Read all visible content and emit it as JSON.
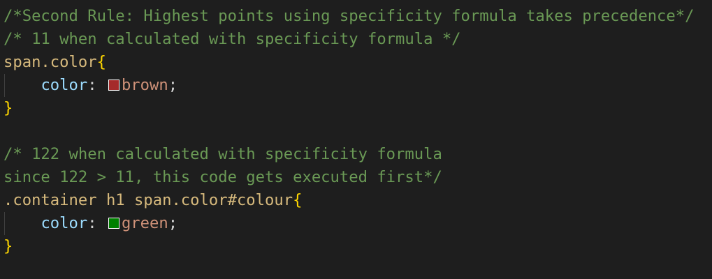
{
  "code": {
    "line1": "/*Second Rule: Highest points using specificity formula takes precedence*/",
    "line2": "/* 11 when calculated with specificity formula */",
    "rule1": {
      "selector": "span.color",
      "open_brace": "{",
      "indent": "    ",
      "property": "color",
      "colon": ": ",
      "value": "brown",
      "semicolon": ";",
      "close_brace": "}",
      "swatch_color": "#a52a2a"
    },
    "line6": "/* 122 when calculated with specificity formula",
    "line7": "since 122 > 11, this code gets executed first*/",
    "rule2": {
      "selector": ".container h1 span.color#colour",
      "open_brace": "{",
      "indent": "    ",
      "property": "color",
      "colon": ": ",
      "value": "green",
      "semicolon": ";",
      "close_brace": "}",
      "swatch_color": "#008000"
    }
  }
}
